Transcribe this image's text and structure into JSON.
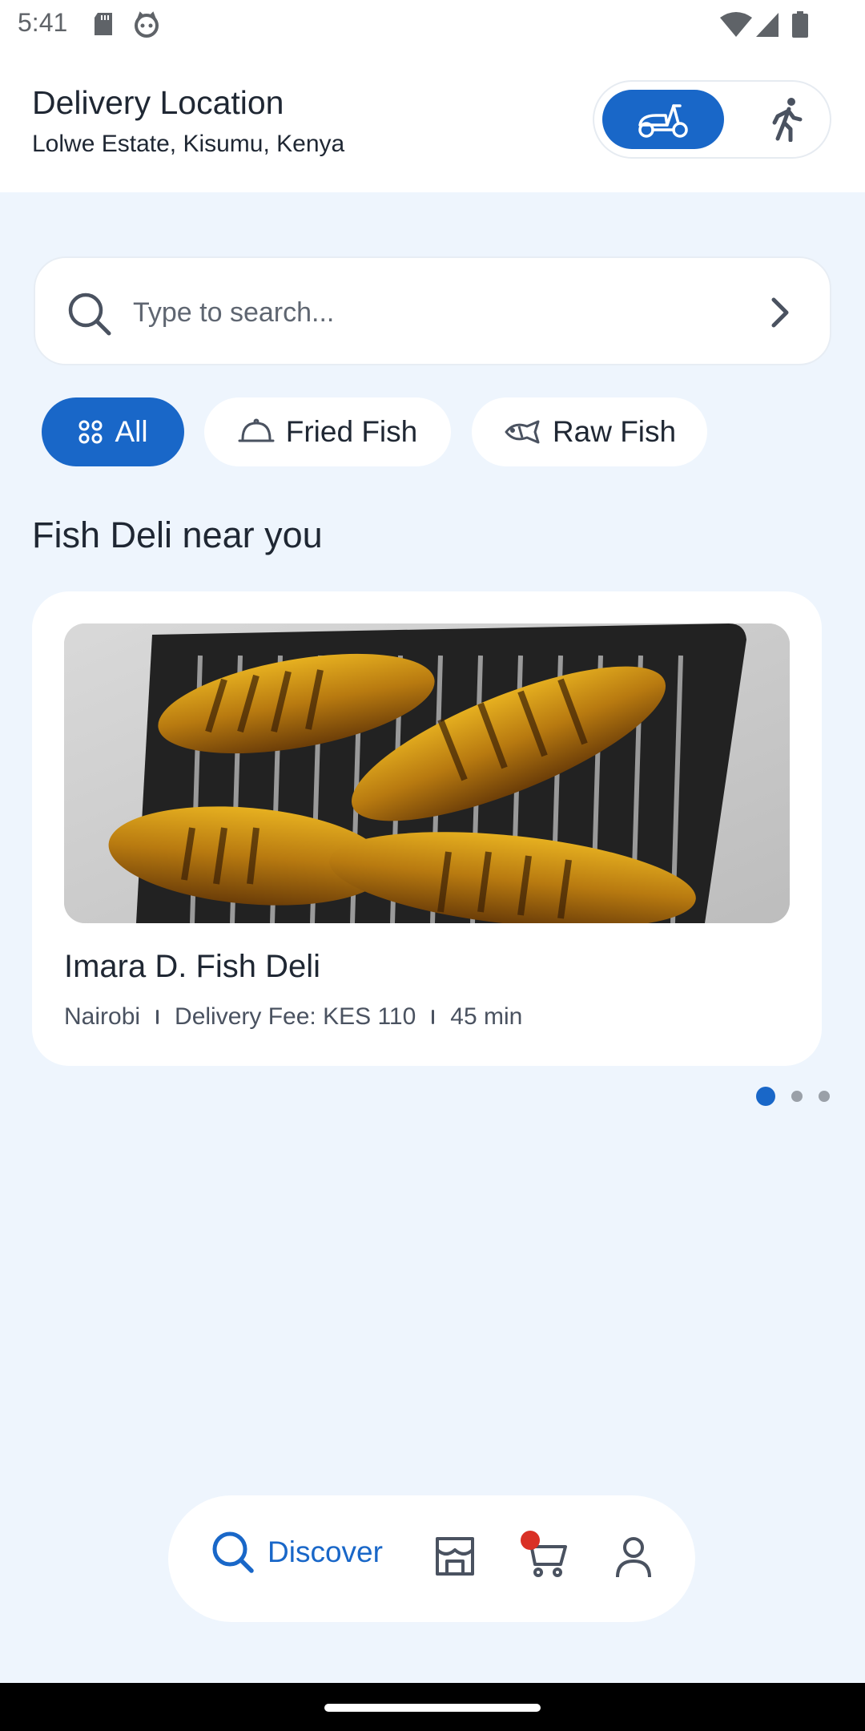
{
  "status_bar": {
    "time": "5:41",
    "icons": [
      "sd-card-icon",
      "cat-face-icon",
      "wifi-icon",
      "signal-icon",
      "battery-icon"
    ]
  },
  "header": {
    "title": "Delivery Location",
    "address": "Lolwe Estate, Kisumu, Kenya",
    "modes": [
      {
        "name": "delivery",
        "icon": "scooter-icon",
        "selected": true
      },
      {
        "name": "pickup",
        "icon": "walking-icon",
        "selected": false
      }
    ]
  },
  "search": {
    "placeholder": "Type to search...",
    "value": ""
  },
  "categories": [
    {
      "label": "All",
      "icon": "grid-dots-icon",
      "selected": true
    },
    {
      "label": "Fried Fish",
      "icon": "cloche-icon",
      "selected": false
    },
    {
      "label": "Raw Fish",
      "icon": "fish-icon",
      "selected": false
    }
  ],
  "section": {
    "title": "Fish Deli near you"
  },
  "restaurant": {
    "name": "Imara D. Fish Deli",
    "location": "Nairobi",
    "delivery_fee": "Delivery Fee: KES 110",
    "eta": "45 min"
  },
  "carousel": {
    "total": 3,
    "active_index": 0
  },
  "nav": {
    "discover_label": "Discover",
    "items": [
      "search-icon",
      "store-icon",
      "cart-icon",
      "profile-icon"
    ],
    "cart_has_badge": true
  },
  "colors": {
    "accent": "#1967c8",
    "background": "#eef5fd",
    "badge": "#d93025"
  }
}
